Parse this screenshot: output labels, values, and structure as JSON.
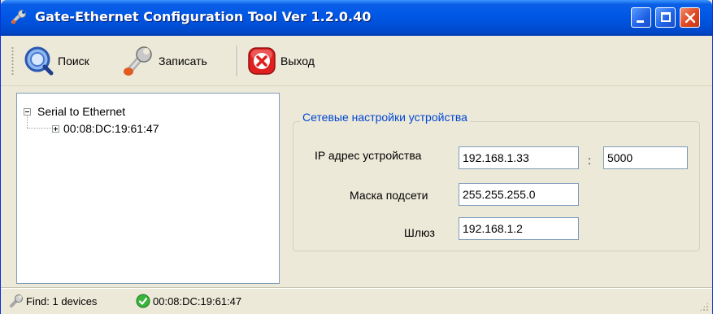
{
  "window": {
    "title": "Gate-Ethernet Configuration Tool Ver 1.2.0.40",
    "title_icon": "wrench-icon"
  },
  "toolbar": {
    "search_label": "Поиск",
    "write_label": "Записать",
    "exit_label": "Выход"
  },
  "tree": {
    "root_label": "Serial to Ethernet",
    "child_label": "00:08:DC:19:61:47"
  },
  "settings": {
    "group_title": "Сетевые настройки устройства",
    "ip_label": "IP адрес устройства",
    "ip_value": "192.168.1.33",
    "colon": ":",
    "port_value": "5000",
    "mask_label": "Маска подсети",
    "mask_value": "255.255.255.0",
    "gateway_label": "Шлюз",
    "gateway_value": "192.168.1.2"
  },
  "status": {
    "find_text": "Find: 1 devices",
    "device_text": "00:08:DC:19:61:47"
  },
  "colors": {
    "title_bar": "#0055E5",
    "group_title": "#0046D5",
    "background": "#ECE9D8"
  }
}
